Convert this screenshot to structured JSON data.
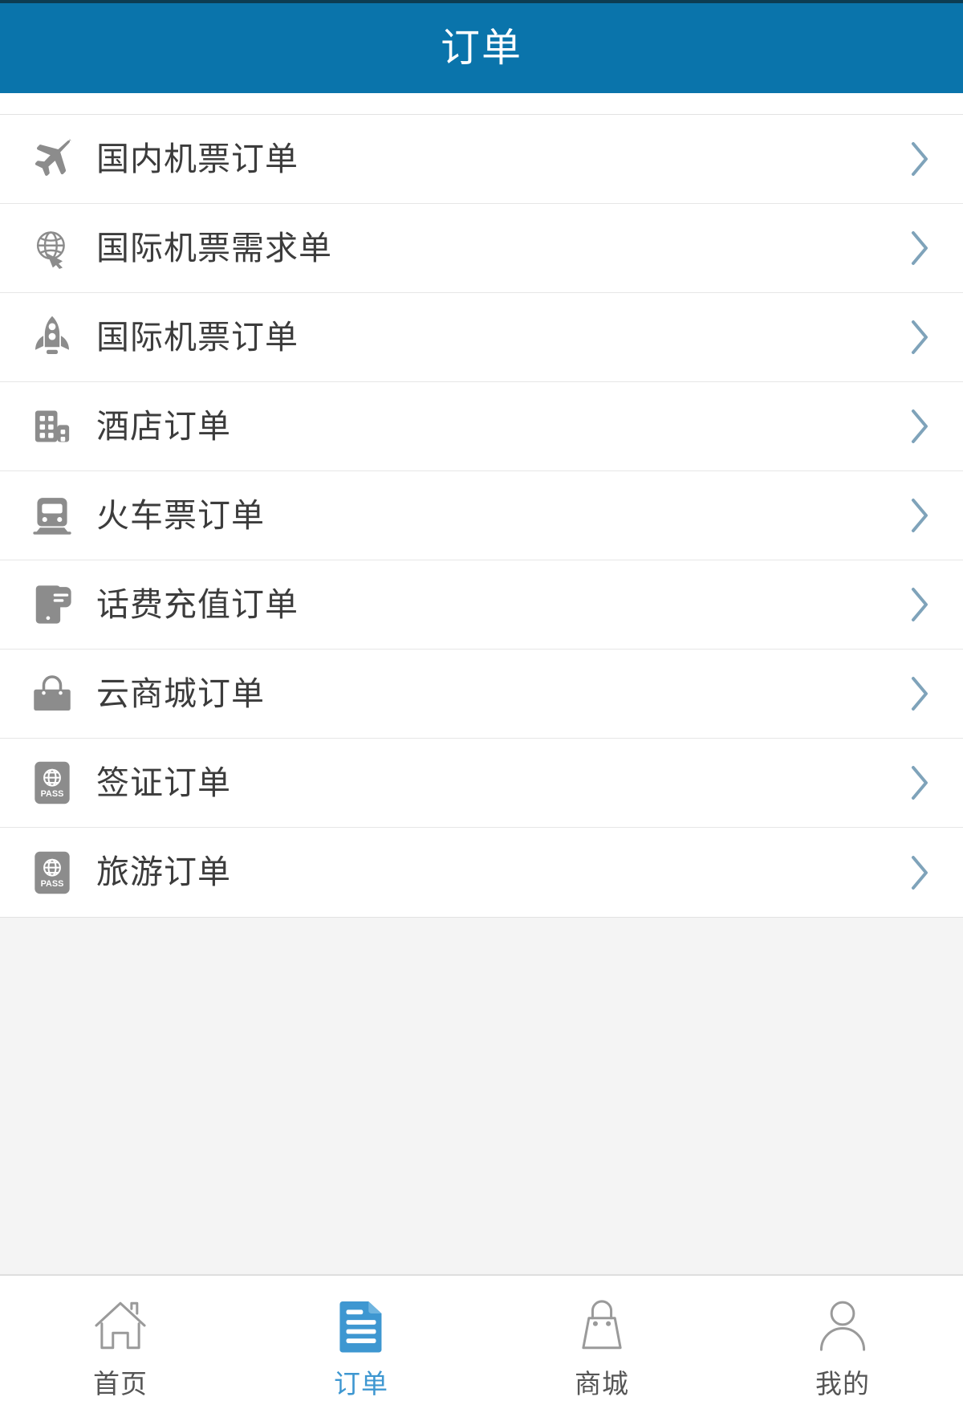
{
  "header": {
    "title": "订单",
    "bg_color": "#0a74ab",
    "text_color": "#ffffff"
  },
  "list": {
    "items": [
      {
        "label": "国内机票订单",
        "icon": "airplane-icon",
        "chevron": "chevron-right-icon"
      },
      {
        "label": "国际机票需求单",
        "icon": "globe-arrow-icon",
        "chevron": "chevron-right-icon"
      },
      {
        "label": "国际机票订单",
        "icon": "rocket-icon",
        "chevron": "chevron-right-icon"
      },
      {
        "label": "酒店订单",
        "icon": "building-icon",
        "chevron": "chevron-right-icon"
      },
      {
        "label": "火车票订单",
        "icon": "train-icon",
        "chevron": "chevron-right-icon"
      },
      {
        "label": "话费充值订单",
        "icon": "phone-message-icon",
        "chevron": "chevron-right-icon"
      },
      {
        "label": "云商城订单",
        "icon": "handbag-icon",
        "chevron": "chevron-right-icon"
      },
      {
        "label": "签证订单",
        "icon": "passport-icon",
        "chevron": "chevron-right-icon"
      },
      {
        "label": "旅游订单",
        "icon": "passport-icon",
        "chevron": "chevron-right-icon"
      }
    ],
    "icon_color": "#8c8c8c",
    "text_color": "#3c3c3c",
    "chevron_color": "#7fa3ba"
  },
  "tabbar": {
    "active_color": "#3e97d1",
    "inactive_color": "#8a8a8a",
    "label_color": "#555555",
    "tabs": [
      {
        "label": "首页",
        "icon": "home-icon",
        "active": false
      },
      {
        "label": "订单",
        "icon": "orders-document-icon",
        "active": true
      },
      {
        "label": "商城",
        "icon": "shopping-bag-icon",
        "active": false
      },
      {
        "label": "我的",
        "icon": "person-icon",
        "active": false
      }
    ]
  },
  "passport_icon_text": "PASS"
}
